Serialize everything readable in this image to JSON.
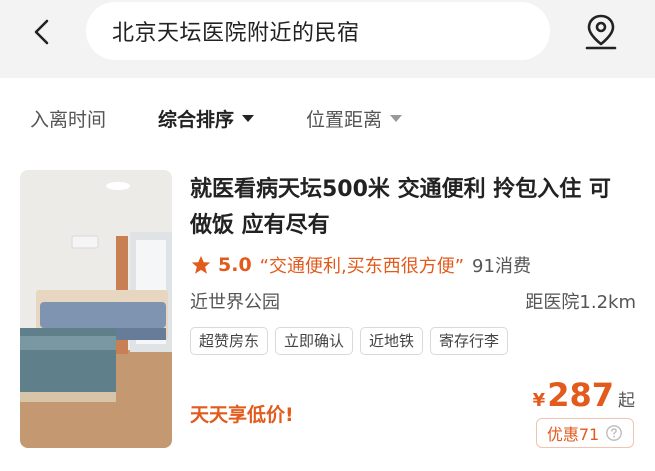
{
  "header": {
    "back_icon": "chevron-left-icon",
    "search_query": "北京天坛医院附近的民宿",
    "map_icon": "map-pin-icon"
  },
  "filters": [
    {
      "label": "入离时间",
      "active": false
    },
    {
      "label": "综合排序",
      "active": true
    },
    {
      "label": "位置距离",
      "active": false
    }
  ],
  "listing": {
    "title": "就医看病天坛500米 交通便利 拎包入住 可做饭 应有尽有",
    "rating": "5.0",
    "quote": "“交通便利,买东西很方便”",
    "consumption": "91消费",
    "location": "近世界公园",
    "distance": "距医院1.2km",
    "tags": [
      "超赞房东",
      "立即确认",
      "近地铁",
      "寄存行李"
    ],
    "promo": "天天享低价!",
    "currency": "¥",
    "price": "287",
    "price_suffix": "起",
    "discount": "优惠71"
  },
  "colors": {
    "accent": "#e25a1c",
    "header_bg": "#f3f3f3",
    "text_primary": "#222222",
    "text_secondary": "#555555"
  }
}
